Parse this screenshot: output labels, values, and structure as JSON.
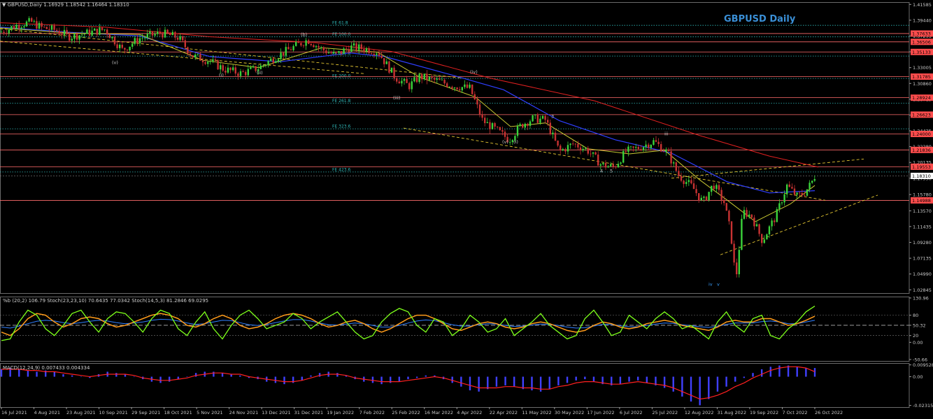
{
  "chart_data": [
    {
      "type": "candlestick",
      "symbol_line": "GBPUSD,Daily  1.16929 1.18542 1.16464 1.18310",
      "title": "GBPUSD Daily",
      "x_ticks": [
        "16 Jul 2021",
        "4 Aug 2021",
        "23 Aug 2021",
        "10 Sep 2021",
        "29 Sep 2021",
        "18 Oct 2021",
        "5 Nov 2021",
        "24 Nov 2021",
        "13 Dec 2021",
        "31 Dec 2021",
        "19 Jan 2022",
        "7 Feb 2022",
        "25 Feb 2022",
        "16 Mar 2022",
        "4 Apr 2022",
        "22 Apr 2022",
        "11 May 2022",
        "30 May 2022",
        "17 Jun 2022",
        "6 Jul 2022",
        "25 Jul 2022",
        "12 Aug 2022",
        "31 Aug 2022",
        "19 Sep 2022",
        "7 Oct 2022",
        "26 Oct 2022"
      ],
      "y_ticks": [
        "1.41585",
        "1.39440",
        "1.37295",
        "1.35150",
        "1.33005",
        "1.30860",
        "1.28715",
        "1.26570",
        "1.24425",
        "1.22280",
        "1.20135",
        "1.17990",
        "1.15780",
        "1.13570",
        "1.11435",
        "1.09280",
        "1.07135",
        "1.04990",
        "1.02845"
      ],
      "ylim": [
        1.024,
        1.419
      ],
      "resistance_levels": [
        {
          "value": 1.37633,
          "label": "1.37633"
        },
        {
          "value": 1.36506,
          "label": "1.36506"
        },
        {
          "value": 1.35133,
          "label": "1.35133"
        },
        {
          "value": 1.31785,
          "label": "1.31785"
        },
        {
          "value": 1.28924,
          "label": "1.28924"
        },
        {
          "value": 1.26623,
          "label": "1.26623"
        },
        {
          "value": 1.24,
          "label": "1.24000"
        },
        {
          "value": 1.21836,
          "label": "1.21836"
        },
        {
          "value": 1.19553,
          "label": "1.19553"
        },
        {
          "value": 1.14988,
          "label": "1.14988"
        }
      ],
      "current_price": {
        "value": 1.1831,
        "label": "1.18310"
      },
      "fib_levels": [
        {
          "value": 1.3875,
          "label": "FE 61.8"
        },
        {
          "value": 1.3718,
          "label": "FE 100.0"
        },
        {
          "value": 1.3458,
          "label": "FE 161.8"
        },
        {
          "value": 1.3154,
          "label": "FE 200.0"
        },
        {
          "value": 1.2818,
          "label": "FE 261.8"
        },
        {
          "value": 1.247,
          "label": "FE 323.6"
        },
        {
          "value": 1.1884,
          "label": "FE 423.6"
        }
      ],
      "wave_labels": [
        "(b)",
        "(v)",
        "(i)",
        "(ii)",
        "(iii)",
        "(iv)",
        "(v)",
        "(i)",
        "3",
        "4",
        "5",
        "iii",
        "iv",
        "v",
        "(5)"
      ],
      "price_path": [
        [
          0,
          1.378
        ],
        [
          25,
          1.388
        ],
        [
          45,
          1.392
        ],
        [
          60,
          1.384
        ],
        [
          80,
          1.381
        ],
        [
          100,
          1.372
        ],
        [
          120,
          1.376
        ],
        [
          150,
          1.382
        ],
        [
          175,
          1.354
        ],
        [
          200,
          1.37
        ],
        [
          230,
          1.377
        ],
        [
          255,
          1.371
        ],
        [
          275,
          1.346
        ],
        [
          300,
          1.339
        ],
        [
          320,
          1.328
        ],
        [
          345,
          1.322
        ],
        [
          370,
          1.33
        ],
        [
          395,
          1.345
        ],
        [
          420,
          1.358
        ],
        [
          440,
          1.368
        ],
        [
          460,
          1.355
        ],
        [
          480,
          1.347
        ],
        [
          500,
          1.358
        ],
        [
          520,
          1.356
        ],
        [
          540,
          1.352
        ],
        [
          565,
          1.317
        ],
        [
          585,
          1.305
        ],
        [
          600,
          1.318
        ],
        [
          625,
          1.312
        ],
        [
          650,
          1.305
        ],
        [
          672,
          1.302
        ],
        [
          690,
          1.258
        ],
        [
          710,
          1.245
        ],
        [
          728,
          1.232
        ],
        [
          745,
          1.252
        ],
        [
          762,
          1.261
        ],
        [
          780,
          1.259
        ],
        [
          800,
          1.216
        ],
        [
          820,
          1.227
        ],
        [
          840,
          1.218
        ],
        [
          860,
          1.198
        ],
        [
          878,
          1.195
        ],
        [
          895,
          1.216
        ],
        [
          915,
          1.222
        ],
        [
          935,
          1.23
        ],
        [
          955,
          1.214
        ],
        [
          970,
          1.184
        ],
        [
          990,
          1.168
        ],
        [
          1005,
          1.147
        ],
        [
          1020,
          1.172
        ],
        [
          1035,
          1.148
        ],
        [
          1045,
          1.105
        ],
        [
          1052,
          1.04
        ],
        [
          1062,
          1.135
        ],
        [
          1075,
          1.128
        ],
        [
          1090,
          1.095
        ],
        [
          1110,
          1.13
        ],
        [
          1125,
          1.17
        ],
        [
          1140,
          1.155
        ],
        [
          1150,
          1.16
        ],
        [
          1160,
          1.173
        ],
        [
          1165,
          1.183
        ]
      ],
      "ema_slow": [
        [
          0,
          1.391
        ],
        [
          150,
          1.385
        ],
        [
          300,
          1.372
        ],
        [
          450,
          1.364
        ],
        [
          560,
          1.352
        ],
        [
          700,
          1.316
        ],
        [
          850,
          1.285
        ],
        [
          1000,
          1.238
        ],
        [
          1100,
          1.21
        ],
        [
          1170,
          1.195
        ]
      ],
      "ema_mid": [
        [
          0,
          1.385
        ],
        [
          100,
          1.378
        ],
        [
          200,
          1.373
        ],
        [
          300,
          1.345
        ],
        [
          400,
          1.338
        ],
        [
          500,
          1.35
        ],
        [
          550,
          1.345
        ],
        [
          650,
          1.319
        ],
        [
          720,
          1.3
        ],
        [
          800,
          1.258
        ],
        [
          880,
          1.232
        ],
        [
          960,
          1.214
        ],
        [
          1040,
          1.175
        ],
        [
          1100,
          1.16
        ],
        [
          1165,
          1.163
        ]
      ],
      "ema_fast": [
        [
          0,
          1.384
        ],
        [
          100,
          1.377
        ],
        [
          200,
          1.375
        ],
        [
          290,
          1.34
        ],
        [
          370,
          1.33
        ],
        [
          460,
          1.357
        ],
        [
          540,
          1.351
        ],
        [
          600,
          1.317
        ],
        [
          680,
          1.29
        ],
        [
          730,
          1.25
        ],
        [
          780,
          1.255
        ],
        [
          840,
          1.22
        ],
        [
          900,
          1.213
        ],
        [
          950,
          1.218
        ],
        [
          1000,
          1.178
        ],
        [
          1040,
          1.15
        ],
        [
          1080,
          1.121
        ],
        [
          1130,
          1.145
        ],
        [
          1165,
          1.17
        ]
      ],
      "channel_lines": [
        {
          "p1": [
            577,
            1.248
          ],
          "p2": [
            1180,
            1.15
          ]
        },
        {
          "p1": [
            1030,
            1.076
          ],
          "p2": [
            1255,
            1.157
          ]
        },
        {
          "p1": [
            960,
            1.18
          ],
          "p2": [
            1235,
            1.206
          ]
        },
        {
          "p1": [
            0,
            1.383
          ],
          "p2": [
            660,
            1.316
          ]
        },
        {
          "p1": [
            0,
            1.366
          ],
          "p2": [
            520,
            1.322
          ]
        }
      ]
    },
    {
      "type": "line",
      "header": "%b (20,2) 106.79  Stoch(23,23,10) 70.6435 77.0342  Stoch(14,5,3) 81.2846 69.0295",
      "y_ticks": [
        "130.96",
        "80",
        "50.32",
        "20",
        "0.00",
        "-50.66"
      ],
      "ylim": [
        -55,
        135
      ],
      "pctb": [
        5,
        10,
        60,
        95,
        80,
        40,
        20,
        50,
        85,
        95,
        60,
        30,
        70,
        90,
        85,
        60,
        30,
        70,
        95,
        85,
        40,
        20,
        60,
        90,
        40,
        10,
        50,
        80,
        95,
        70,
        40,
        50,
        60,
        85,
        70,
        40,
        60,
        75,
        90,
        60,
        30,
        10,
        20,
        60,
        85,
        100,
        90,
        50,
        30,
        70,
        60,
        20,
        40,
        80,
        60,
        30,
        40,
        70,
        20,
        40,
        60,
        85,
        50,
        30,
        10,
        20,
        70,
        95,
        60,
        20,
        30,
        80,
        60,
        40,
        70,
        90,
        70,
        40,
        50,
        30,
        10,
        60,
        90,
        50,
        30,
        70,
        80,
        20,
        10,
        40,
        60,
        90,
        107
      ],
      "stoch_slow": [
        30,
        20,
        40,
        70,
        85,
        80,
        60,
        45,
        55,
        70,
        75,
        70,
        55,
        45,
        50,
        60,
        70,
        80,
        85,
        80,
        70,
        50,
        45,
        55,
        70,
        80,
        70,
        50,
        40,
        45,
        55,
        70,
        80,
        85,
        80,
        70,
        55,
        45,
        50,
        60,
        65,
        55,
        40,
        30,
        40,
        55,
        70,
        80,
        80,
        70,
        55,
        40,
        35,
        45,
        55,
        60,
        55,
        45,
        40,
        45,
        55,
        60,
        55,
        45,
        35,
        30,
        35,
        50,
        60,
        55,
        45,
        40,
        45,
        55,
        60,
        65,
        60,
        50,
        45,
        40,
        35,
        45,
        60,
        65,
        60,
        60,
        70,
        70,
        60,
        50,
        55,
        65,
        77
      ],
      "ma_line": [
        45,
        42,
        48,
        55,
        62,
        65,
        63,
        58,
        55,
        58,
        62,
        65,
        63,
        58,
        55,
        57,
        60,
        65,
        68,
        67,
        63,
        57,
        53,
        55,
        60,
        65,
        64,
        58,
        52,
        50,
        53,
        58,
        63,
        67,
        67,
        63,
        57,
        52,
        51,
        54,
        57,
        55,
        50,
        45,
        45,
        50,
        57,
        63,
        66,
        64,
        58,
        52,
        48,
        48,
        52,
        55,
        54,
        50,
        47,
        48,
        51,
        54,
        53,
        50,
        45,
        42,
        43,
        48,
        53,
        53,
        49,
        46,
        46,
        50,
        54,
        57,
        56,
        52,
        49,
        46,
        44,
        47,
        53,
        57,
        57,
        57,
        61,
        63,
        60,
        55,
        55,
        60,
        65
      ]
    },
    {
      "type": "bar",
      "header": "MACD(12,24,9) 0.007433 0.004334",
      "y_ticks": [
        "0.009528",
        "0.00",
        "-0.023153"
      ],
      "ylim": [
        -0.0245,
        0.011
      ],
      "histogram": [
        0.006,
        0.007,
        0.006,
        0.005,
        0.004,
        0.005,
        0.004,
        0.002,
        0.001,
        0.0,
        -0.001,
        0.002,
        0.004,
        0.003,
        0.002,
        0.0,
        -0.002,
        -0.004,
        -0.005,
        -0.004,
        -0.002,
        0.0,
        0.003,
        0.004,
        0.004,
        0.003,
        0.002,
        0.001,
        -0.001,
        -0.002,
        -0.004,
        -0.005,
        -0.006,
        -0.005,
        -0.003,
        0.001,
        0.003,
        0.004,
        0.003,
        0.001,
        -0.002,
        -0.004,
        -0.005,
        -0.006,
        -0.005,
        -0.004,
        -0.002,
        -0.001,
        0.001,
        0.001,
        -0.002,
        -0.005,
        -0.008,
        -0.011,
        -0.012,
        -0.01,
        -0.008,
        -0.007,
        -0.008,
        -0.01,
        -0.011,
        -0.012,
        -0.01,
        -0.007,
        -0.005,
        -0.003,
        -0.002,
        -0.004,
        -0.006,
        -0.007,
        -0.006,
        -0.004,
        -0.003,
        -0.005,
        -0.007,
        -0.009,
        -0.012,
        -0.016,
        -0.02,
        -0.023,
        -0.018,
        -0.012,
        -0.008,
        -0.004,
        -0.001,
        0.003,
        0.006,
        0.008,
        0.009,
        0.009,
        0.008,
        0.007,
        0.007
      ],
      "signal": [
        0.006,
        0.006,
        0.006,
        0.005,
        0.005,
        0.004,
        0.004,
        0.003,
        0.002,
        0.001,
        0.0,
        0.001,
        0.002,
        0.002,
        0.002,
        0.001,
        -0.001,
        -0.002,
        -0.003,
        -0.003,
        -0.002,
        -0.001,
        0.001,
        0.002,
        0.003,
        0.003,
        0.002,
        0.002,
        0.0,
        -0.001,
        -0.002,
        -0.003,
        -0.004,
        -0.004,
        -0.003,
        -0.001,
        0.001,
        0.002,
        0.002,
        0.001,
        -0.001,
        -0.002,
        -0.003,
        -0.004,
        -0.004,
        -0.004,
        -0.003,
        -0.002,
        -0.001,
        0.0,
        -0.001,
        -0.003,
        -0.005,
        -0.007,
        -0.009,
        -0.009,
        -0.009,
        -0.008,
        -0.008,
        -0.009,
        -0.009,
        -0.01,
        -0.01,
        -0.008,
        -0.007,
        -0.005,
        -0.004,
        -0.004,
        -0.005,
        -0.006,
        -0.006,
        -0.005,
        -0.004,
        -0.005,
        -0.006,
        -0.007,
        -0.009,
        -0.012,
        -0.015,
        -0.018,
        -0.017,
        -0.015,
        -0.012,
        -0.008,
        -0.005,
        -0.001,
        0.002,
        0.005,
        0.007,
        0.008,
        0.008,
        0.007,
        0.004
      ]
    }
  ],
  "colors": {
    "background": "#000000",
    "bull": "#3ad13a",
    "bear": "#c83232",
    "resistance": "#ff6b6b",
    "fib": "#2fb8b8",
    "ema_slow": "#e02020",
    "ema_mid": "#2f3fff",
    "ema_fast": "#c8c832",
    "channel": "#e6c832",
    "price_tag": "#ff4d4d",
    "title": "#3a8fd6",
    "pctb": "#7dff1a",
    "stoch": "#ff9b1a",
    "stoch_ma": "#2f7fff",
    "macd_hist": "#4040ff",
    "macd_signal": "#ff2020"
  }
}
